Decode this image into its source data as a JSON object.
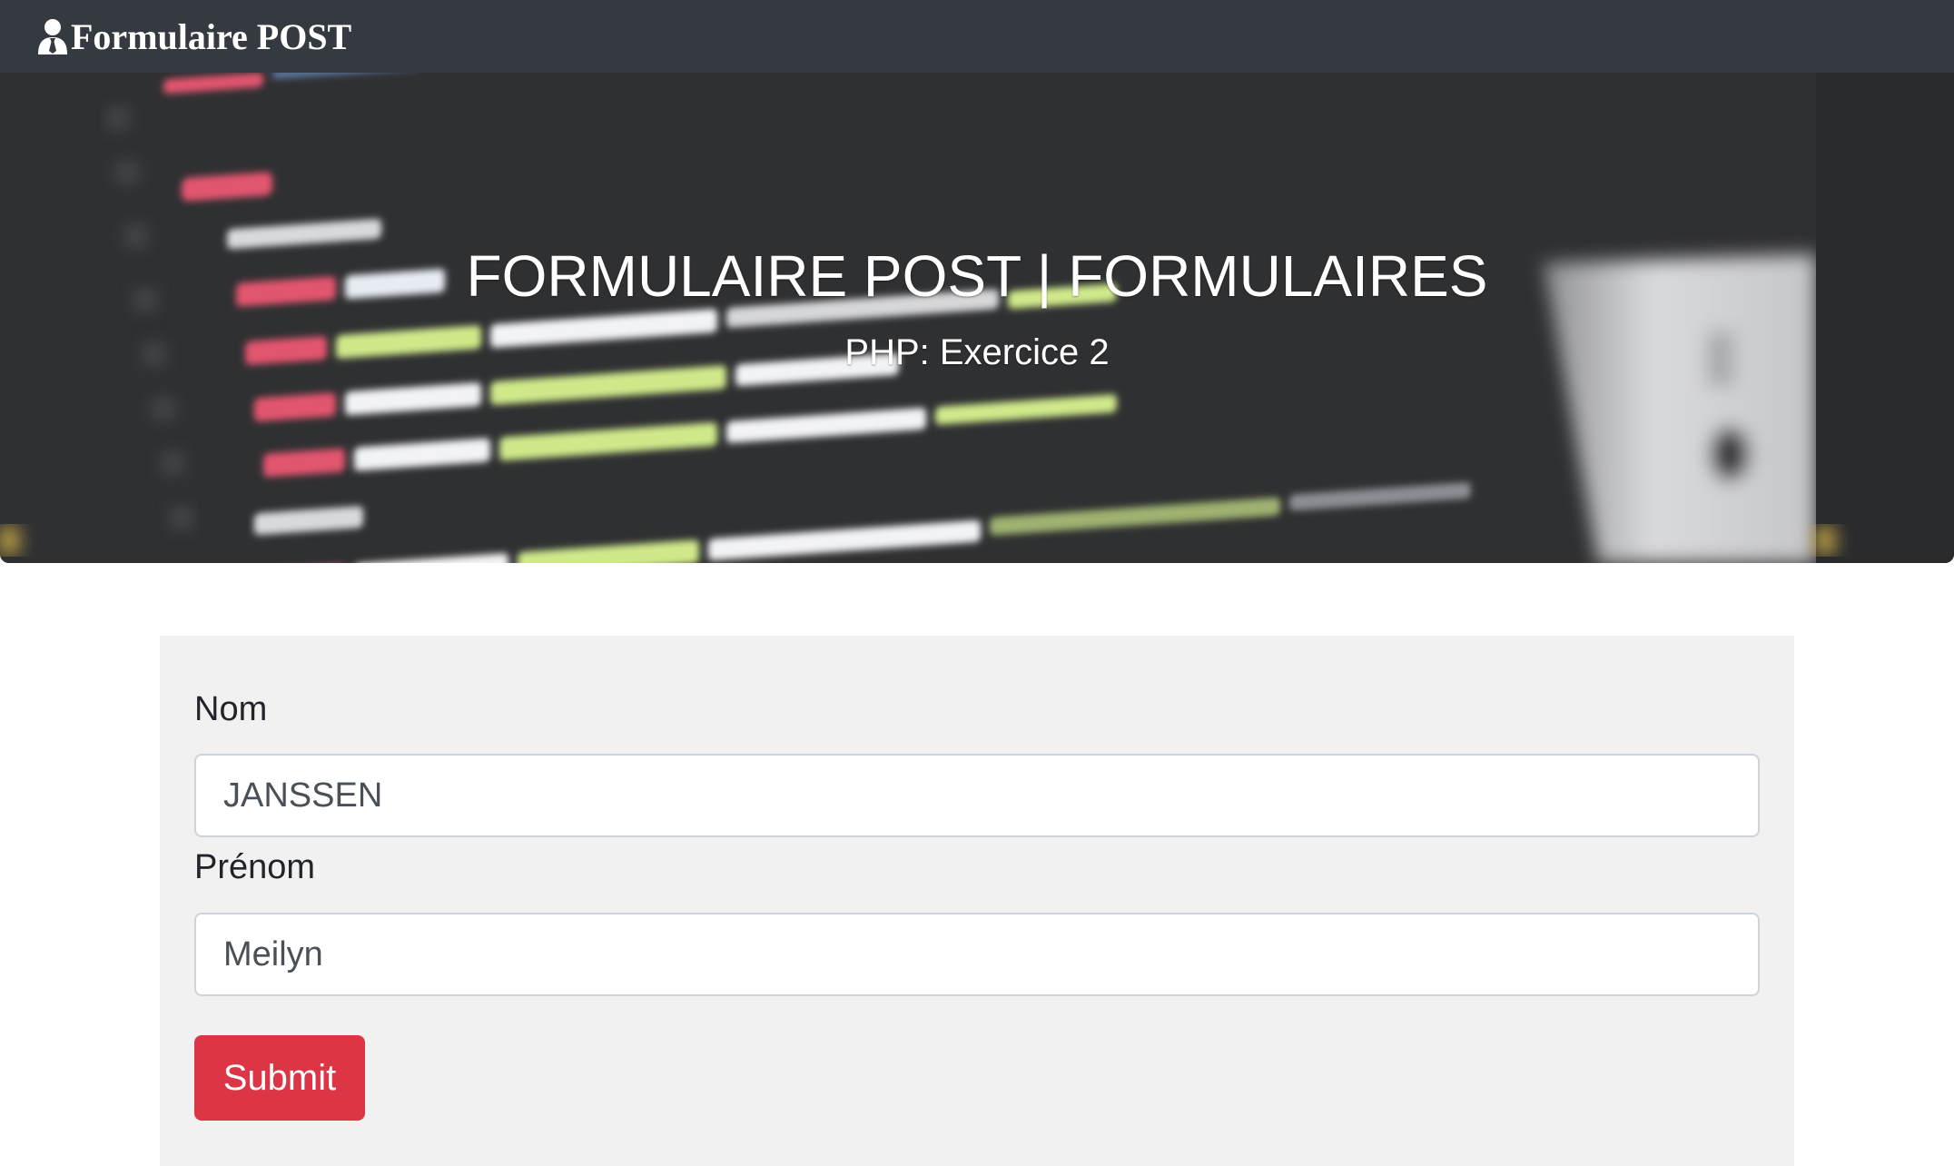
{
  "navbar": {
    "brand_label": "Formulaire POST",
    "brand_icon": "user-tie-icon"
  },
  "hero": {
    "title": "FORMULAIRE POST | FORMULAIRES",
    "subtitle": "PHP: Exercice 2",
    "background": "blurred-code-photo"
  },
  "form": {
    "nom_label": "Nom",
    "nom_value": "JANSSEN",
    "prenom_label": "Prénom",
    "prenom_value": "Meilyn",
    "submit_label": "Submit"
  },
  "colors": {
    "navbar": "#343a40",
    "submit": "#dc3545",
    "panel": "#f1f1f1"
  }
}
